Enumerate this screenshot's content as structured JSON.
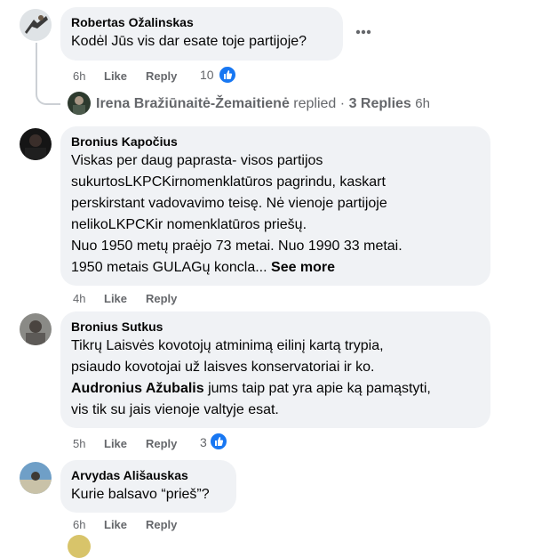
{
  "comments": [
    {
      "author": "Robertas Ožalinskas",
      "text": "Kodėl Jūs vis dar esate toje partijoje?",
      "time": "6h",
      "like": "Like",
      "reply": "Reply",
      "reactions": "10",
      "more_icon": "more-horizontal-icon"
    },
    {
      "author": "Bronius Kapočius",
      "lines": [
        "Viskas per daug paprasta- visos partijos",
        "sukurtosLKPCKirnomenklatūros pagrindu, kaskart",
        "perskirstant vadovavimo teisę. Nė vienoje partijoje",
        "nelikoLKPCKir nomenklatūros priešų.",
        "Nuo 1950 metų praėjo 73 metai. Nuo 1990 33 metai.",
        "1950 metais GULAGų koncla..."
      ],
      "see_more": "See more",
      "time": "4h",
      "like": "Like",
      "reply": "Reply"
    },
    {
      "author": "Bronius Sutkus",
      "lines": [
        "Tikrų Laisvės kovotojų atminimą eilinį kartą trypia,",
        "psiaudo kovotojai už laisves konservatoriai ir ko."
      ],
      "mention": "Audronius Ažubalis",
      "mention_rest": " jums taip pat yra apie ką pamąstyti,",
      "last_line": "vis tik su jais vienoje valtyje esat.",
      "time": "5h",
      "like": "Like",
      "reply": "Reply",
      "reactions": "3"
    },
    {
      "author": "Arvydas Ališauskas",
      "text": "Kurie balsavo “prieš”?",
      "time": "6h",
      "like": "Like",
      "reply": "Reply"
    }
  ],
  "replied_row": {
    "name": "Irena Bražiūnaitė-Žemaitienė",
    "action": "replied",
    "separator": "·",
    "replies": "3 Replies",
    "time": "6h"
  }
}
